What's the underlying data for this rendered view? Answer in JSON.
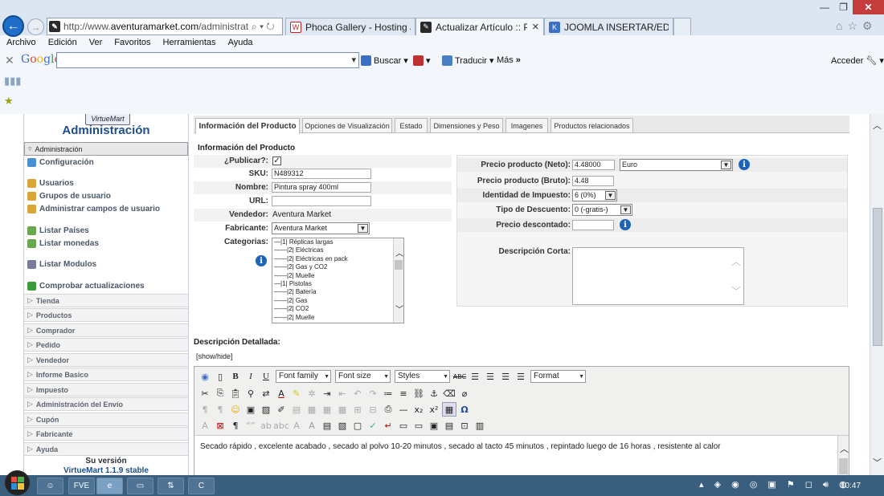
{
  "browser": {
    "address_host": "http://www.",
    "address_domain": "aventuramarket.com",
    "address_path": "/administrator/index",
    "address_icons": "⌕ ▾ ↻",
    "tabs": [
      {
        "label": "Phoca Gallery - Hosting Jooml...",
        "icon": "W"
      },
      {
        "label": "Actualizar Artículo :: Pintura...",
        "icon": "✎"
      },
      {
        "label": "JOOMLA INSERTAR/EDITAR E...",
        "icon": "K"
      }
    ],
    "menu": [
      "Archivo",
      "Edición",
      "Ver",
      "Favoritos",
      "Herramientas",
      "Ayuda"
    ],
    "google_logo": "Google",
    "buscar_label": "Buscar",
    "traducir_label": "Traducir",
    "mas_label": "Más",
    "acceder_label": "Acceder",
    "window_controls": {
      "minimize": "—",
      "restore": "❐",
      "close": "✕"
    }
  },
  "sidebar": {
    "logo": "VirtueMart",
    "title": "Administración",
    "active_item": "Administración",
    "links": [
      {
        "label": "Configuración",
        "color": "#4a8fd1"
      },
      {
        "label": "Usuarios",
        "color": "#d9a63a"
      },
      {
        "label": "Grupos de usuario",
        "color": "#d9a63a"
      },
      {
        "label": "Administrar campos de usuario",
        "color": "#d9a63a"
      },
      {
        "label": "Listar Países",
        "color": "#6aa84f"
      },
      {
        "label": "Listar monedas",
        "color": "#6aa84f"
      },
      {
        "label": "Listar Modulos",
        "color": "#7a7a9a"
      },
      {
        "label": "Comprobar actualizaciones",
        "color": "#3d9a3d"
      }
    ],
    "sections": [
      "Tienda",
      "Productos",
      "Comprador",
      "Pedido",
      "Vendedor",
      "Informe Basico",
      "Impuesto",
      "Administración del Envío",
      "Cupón",
      "Fabricante",
      "Ayuda"
    ],
    "version_label": "Su versión",
    "version": "VirtueMart 1.1.9 stable"
  },
  "product_tabs": [
    "Información del Producto",
    "Opciones de Visualización",
    "Estado",
    "Dimensiones y Peso",
    "Imagenes",
    "Productos relacionados"
  ],
  "product_info": {
    "section_title": "Información del Producto",
    "publicar_label": "¿Publicar?:",
    "publicar_checked": "✓",
    "sku_label": "SKU:",
    "sku_value": "N489312",
    "nombre_label": "Nombre:",
    "nombre_value": "Pintura spray 400ml",
    "url_label": "URL:",
    "url_value": "",
    "vendedor_label": "Vendedor:",
    "vendedor_value": "Aventura Market",
    "fabricante_label": "Fabricante:",
    "fabricante_value": "Aventura Market",
    "categorias_label": "Categorias:",
    "categorias": [
      "—|1| Réplicas largas",
      "——|2| Eléctricas",
      "——|2| Eléctricas en pack",
      "——|2| Gas y CO2",
      "——|2| Muelle",
      "—|1| Pistolas",
      "——|2| Batería",
      "——|2| Gas",
      "——|2| CO2",
      "——|2| Muelle"
    ]
  },
  "pricing": {
    "neto_label": "Precio producto (Neto):",
    "neto_value": "4.48000",
    "currency": "Euro",
    "bruto_label": "Precio producto (Bruto):",
    "bruto_value": "4.48",
    "impuesto_label": "Identidad de Impuesto:",
    "impuesto_value": "6 (0%)",
    "descuento_label": "Tipo de Descuento:",
    "descuento_value": "0 (-gratis-)",
    "descontado_label": "Precio descontado:",
    "descontado_value": "",
    "desc_corta_label": "Descripción Corta:"
  },
  "detail": {
    "title": "Descripción Detallada:",
    "showhide": "[show/hide]",
    "font_family": "Font family",
    "font_size": "Font size",
    "styles": "Styles",
    "format": "Format",
    "text": "Secado rápido , excelente acabado , secado al polvo 10-20 minutos , secado al tacto 45 minutos , repintado luego de 16 horas , resistente al calor"
  },
  "taskbar": {
    "clock": "10:47",
    "apps": [
      "☺",
      "FVE",
      "e",
      "▭",
      "⇅",
      "C"
    ]
  },
  "colors": {
    "admin_blue": "#1f4e8c",
    "info_blue": "#1d63b8",
    "taskbar": "#3a5e7e"
  }
}
